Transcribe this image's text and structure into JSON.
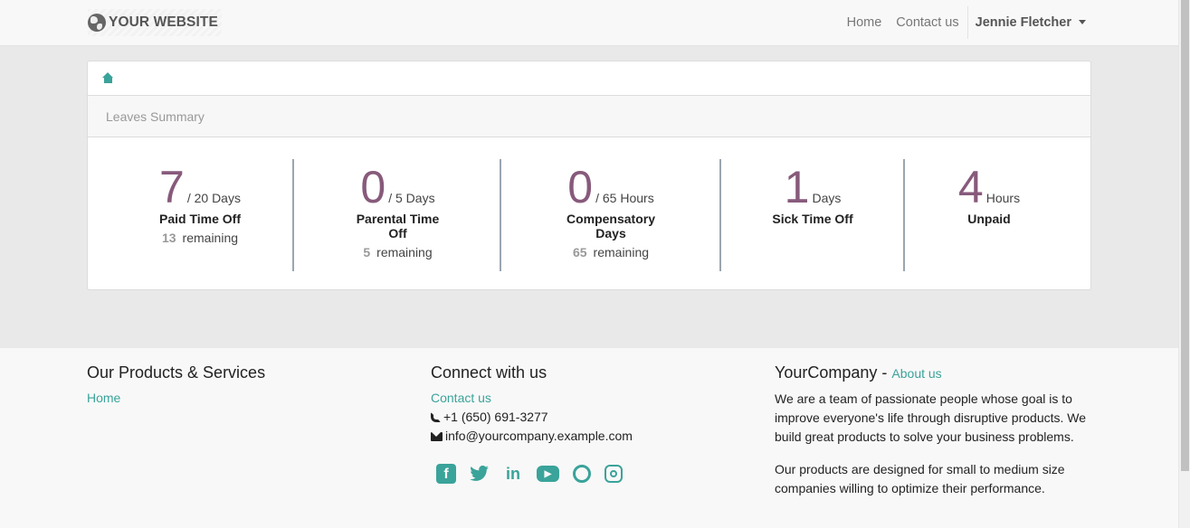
{
  "header": {
    "brand": "YOUR WEBSITE",
    "nav": [
      "Home",
      "Contact us"
    ],
    "user": "Jennie Fletcher"
  },
  "card": {
    "title": "Leaves Summary",
    "stats": [
      {
        "value": "7",
        "unit": "/ 20 Days",
        "name": "Paid Time Off",
        "remaining_value": "13",
        "remaining_label": "remaining"
      },
      {
        "value": "0",
        "unit": "/ 5 Days",
        "name": "Parental Time Off",
        "remaining_value": "5",
        "remaining_label": "remaining"
      },
      {
        "value": "0",
        "unit": "/ 65 Hours",
        "name": "Compensatory Days",
        "remaining_value": "65",
        "remaining_label": "remaining"
      },
      {
        "value": "1",
        "unit": "Days",
        "name": "Sick Time Off"
      },
      {
        "value": "4",
        "unit": "Hours",
        "name": "Unpaid"
      }
    ]
  },
  "footer": {
    "col1": {
      "title": "Our Products & Services",
      "links": [
        "Home"
      ]
    },
    "col2": {
      "title": "Connect with us",
      "contact_link": "Contact us",
      "phone": "+1 (650) 691-3277",
      "email": "info@yourcompany.example.com",
      "social": [
        "facebook-icon",
        "twitter-icon",
        "linkedin-icon",
        "youtube-icon",
        "github-icon",
        "instagram-icon"
      ]
    },
    "col3": {
      "title": "YourCompany",
      "separator": " - ",
      "about_link": "About us",
      "p1": "We are a team of passionate people whose goal is to improve everyone's life through disruptive products. We build great products to solve your business problems.",
      "p2": "Our products are designed for small to medium size companies willing to optimize their performance."
    }
  },
  "colors": {
    "accent": "#3aa39a",
    "primary": "#875a7b"
  }
}
